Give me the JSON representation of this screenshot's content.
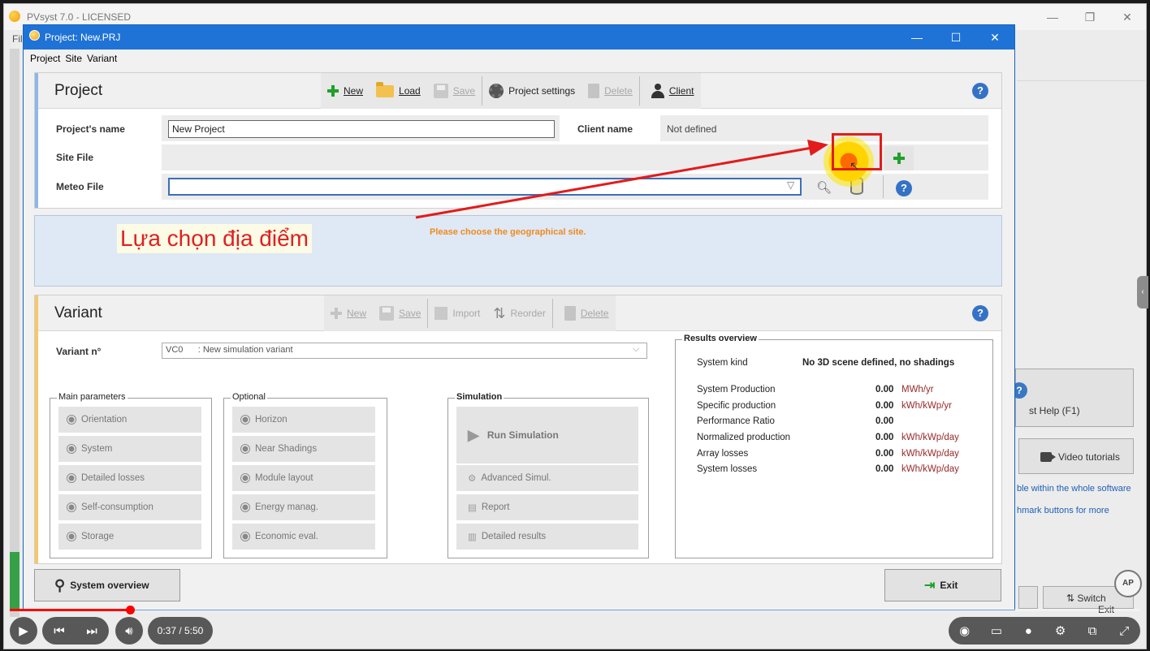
{
  "outer_window": {
    "title": "PVsyst 7.0 - LICENSED",
    "menu_fragment": "Fil",
    "controls": [
      "—",
      "❐",
      "✕"
    ],
    "help_button": "st Help (F1)",
    "video_button": "Video tutorials",
    "link1": "ble within the whole software",
    "link2": "hmark buttons for more",
    "switch_button": "Switch",
    "exit_fragment": "Exit"
  },
  "dialog": {
    "title": "Project: New.PRJ",
    "controls": [
      "—",
      "☐",
      "✕"
    ],
    "menu": [
      "Project",
      "Site",
      "Variant"
    ]
  },
  "project": {
    "heading": "Project",
    "toolbar": {
      "new": "New",
      "load": "Load",
      "save": "Save",
      "settings": "Project settings",
      "delete": "Delete",
      "client": "Client"
    },
    "name_label": "Project's name",
    "name_value": "New Project",
    "client_label": "Client name",
    "client_value": "Not defined",
    "site_label": "Site File",
    "meteo_label": "Meteo File",
    "meteo_value": ""
  },
  "message": "Please choose the geographical site.",
  "annotation": "Lựa chọn địa điểm",
  "variant": {
    "heading": "Variant",
    "toolbar": {
      "new": "New",
      "save": "Save",
      "import": "Import",
      "reorder": "Reorder",
      "delete": "Delete"
    },
    "number_label": "Variant n°",
    "number_value": "VC0      : New simulation variant",
    "main_params": {
      "title": "Main parameters",
      "items": [
        "Orientation",
        "System",
        "Detailed losses",
        "Self-consumption",
        "Storage"
      ]
    },
    "optional": {
      "title": "Optional",
      "items": [
        "Horizon",
        "Near Shadings",
        "Module layout",
        "Energy manag.",
        "Economic eval."
      ]
    },
    "simulation": {
      "title": "Simulation",
      "run": "Run Simulation",
      "advanced": "Advanced Simul.",
      "report": "Report",
      "detailed": "Detailed results"
    },
    "results": {
      "title": "Results overview",
      "system_kind_label": "System kind",
      "system_kind_value": "No 3D scene defined, no shadings",
      "rows": [
        {
          "label": "System Production",
          "value": "0.00",
          "unit": "MWh/yr"
        },
        {
          "label": "Specific production",
          "value": "0.00",
          "unit": "kWh/kWp/yr"
        },
        {
          "label": "Performance Ratio",
          "value": "0.00",
          "unit": ""
        },
        {
          "label": "Normalized production",
          "value": "0.00",
          "unit": "kWh/kWp/day"
        },
        {
          "label": "Array losses",
          "value": "0.00",
          "unit": "kWh/kWp/day"
        },
        {
          "label": "System losses",
          "value": "0.00",
          "unit": "kWh/kWp/day"
        }
      ]
    }
  },
  "bottom": {
    "system_overview": "System overview",
    "exit": "Exit"
  },
  "video_player": {
    "time": "0:37 / 5:50",
    "progress": 0.106,
    "logo_text": "AP"
  },
  "colors": {
    "dialog_title_bar": "#1f73d6",
    "annotation_red": "#e02020",
    "message_orange": "#ef8b1e",
    "unit_red": "#9a2a2a"
  }
}
